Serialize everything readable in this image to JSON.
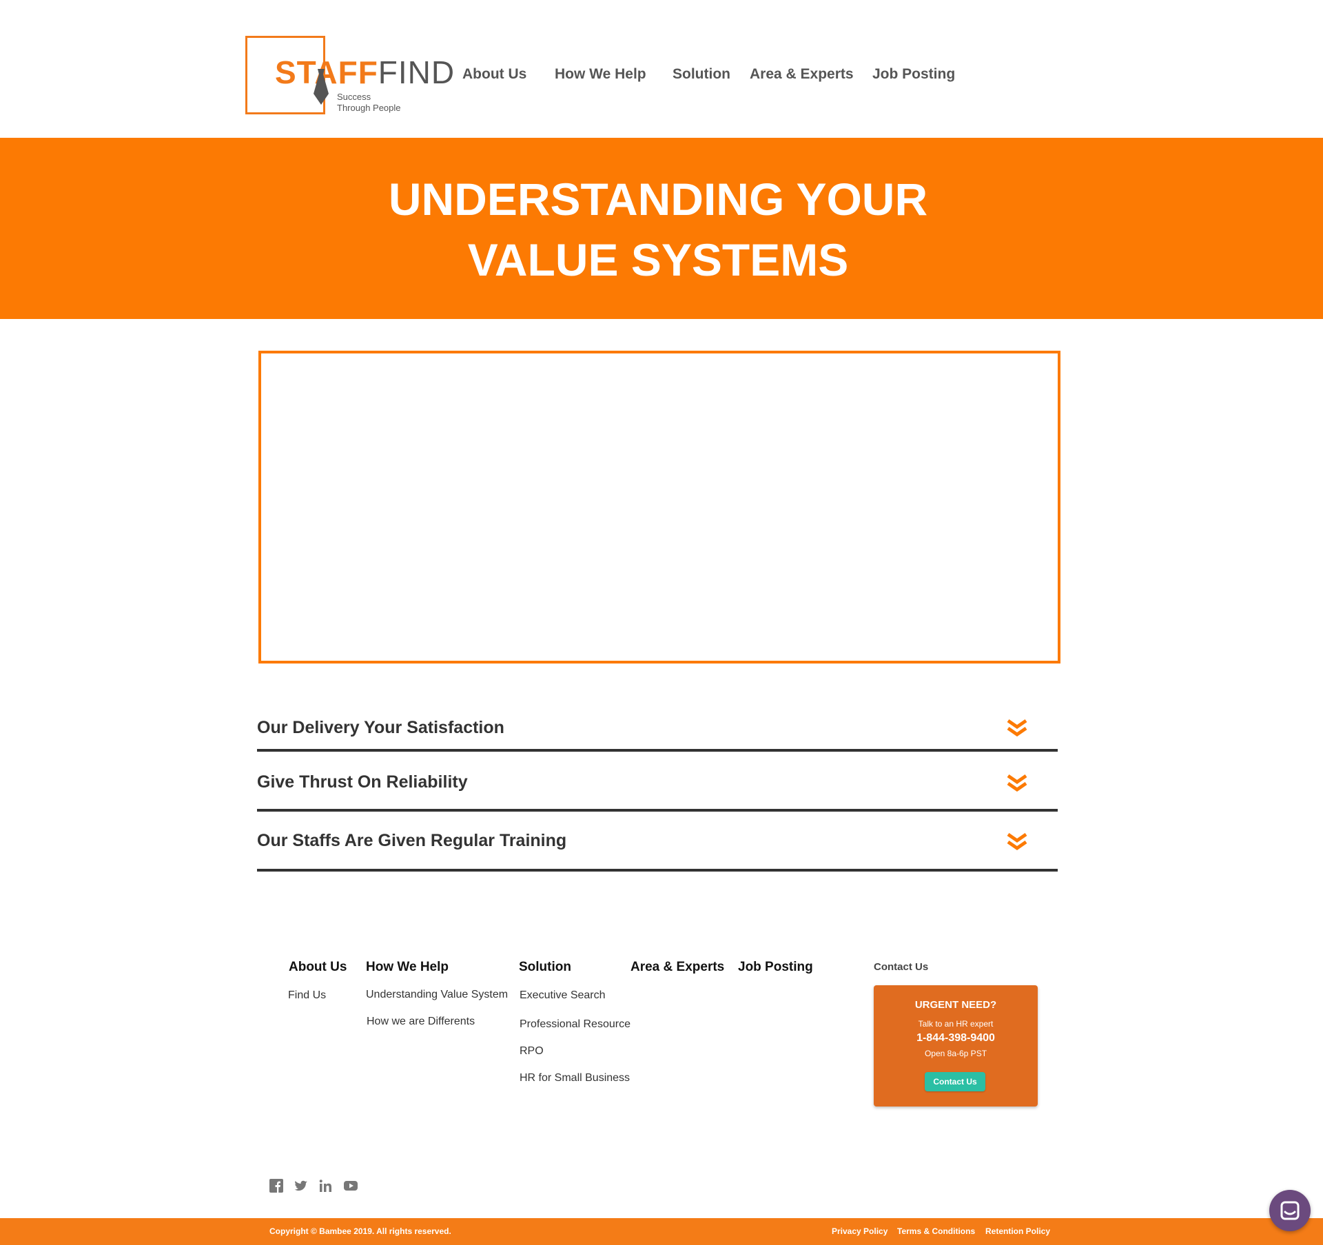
{
  "logo": {
    "word_staff": "STAF",
    "word_find": "FIND",
    "tagline_1": "Success",
    "tagline_2": "Through People",
    "brand_color": "#f27a1a"
  },
  "nav": {
    "items": [
      {
        "label": "About Us"
      },
      {
        "label": "How We Help"
      },
      {
        "label": "Solution"
      },
      {
        "label": "Area & Experts"
      },
      {
        "label": "Job Posting"
      }
    ]
  },
  "hero": {
    "title_line_1": "UNDERSTANDING YOUR",
    "title_line_2": "VALUE SYSTEMS",
    "background": "#fc7a03"
  },
  "accordion": {
    "items": [
      {
        "title": "Our Delivery Your Satisfaction",
        "icon": "double-chevron-down-icon"
      },
      {
        "title": "Give Thrust On Reliability",
        "icon": "double-chevron-down-icon"
      },
      {
        "title": "Our Staffs Are Given Regular Training",
        "icon": "double-chevron-down-icon"
      }
    ]
  },
  "footer": {
    "columns": [
      {
        "heading": "About Us",
        "links": [
          "Find  Us"
        ]
      },
      {
        "heading": "How We Help",
        "links": [
          "Understanding Value System",
          "How we are Differents"
        ]
      },
      {
        "heading": "Solution",
        "links": [
          "Executive Search",
          "Professional Resource",
          "RPO",
          "HR for Small Business"
        ]
      },
      {
        "heading": "Area & Experts",
        "links": []
      },
      {
        "heading": "Job Posting",
        "links": []
      }
    ],
    "contact_label": "Contact Us",
    "urgent": {
      "title": "URGENT NEED?",
      "subtitle": "Talk to an HR expert",
      "phone": "1-844-398-9400",
      "hours": "Open 8a-6p PST",
      "button": "Contact Us"
    },
    "social": [
      "facebook-icon",
      "twitter-icon",
      "linkedin-icon",
      "youtube-icon"
    ]
  },
  "bottom_bar": {
    "copyright": "Copyright © Bambee 2019. All rights reserved.",
    "links": [
      "Privacy Policy",
      "Terms & Conditions",
      "Retention Policy"
    ]
  },
  "chat": {
    "icon": "chat-icon",
    "color": "#6b4a7e"
  }
}
